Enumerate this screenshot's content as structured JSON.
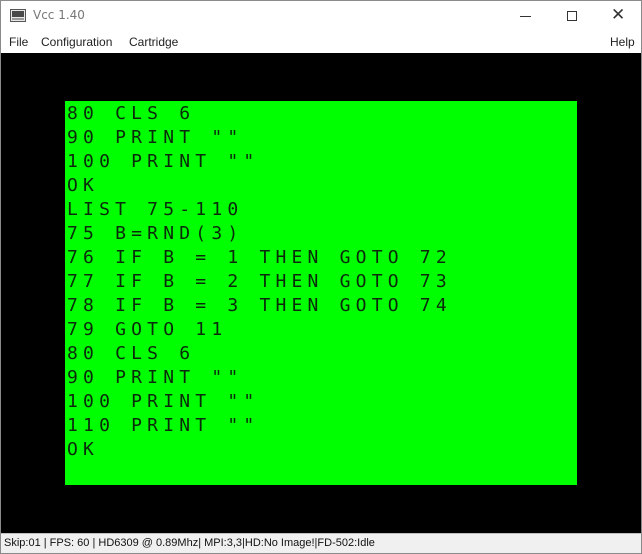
{
  "window": {
    "title": "Vcc 1.40",
    "icon": "computer-icon"
  },
  "titlebar_buttons": {
    "minimize_icon": "minimize-icon",
    "maximize_icon": "maximize-icon",
    "close_icon": "close-icon",
    "close_glyph": "✕"
  },
  "menubar": {
    "items": [
      "File",
      "Configuration",
      "Cartridge"
    ],
    "help": "Help"
  },
  "screen": {
    "background_color": "#00ff00",
    "text_color": "#0b2a0b",
    "border_color": "#000000",
    "lines": [
      "80 CLS 6",
      "90 PRINT \"\"",
      "100 PRINT \"\"",
      "OK",
      "LIST 75-110",
      "75 B=RND(3)",
      "76 IF B = 1 THEN GOTO 72",
      "77 IF B = 2 THEN GOTO 73",
      "78 IF B = 3 THEN GOTO 74",
      "79 GOTO 11",
      "80 CLS 6",
      "90 PRINT \"\"",
      "100 PRINT \"\"",
      "110 PRINT \"\"",
      "OK"
    ]
  },
  "statusbar": {
    "text": "Skip:01 | FPS: 60 | HD6309 @ 0.89Mhz| MPI:3,3|HD:No Image!|FD-502:Idle"
  }
}
